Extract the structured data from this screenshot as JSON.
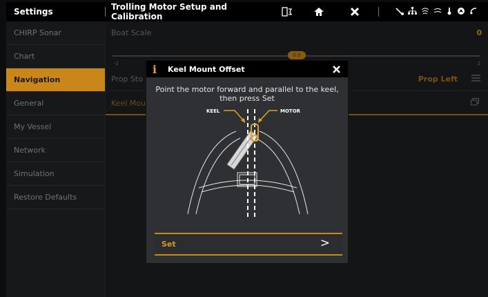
{
  "topbar": {
    "settings_title": "Settings",
    "page_title": "Trolling Motor Setup and Calibration"
  },
  "sidebar": {
    "items": [
      {
        "label": "CHIRP Sonar"
      },
      {
        "label": "Chart"
      },
      {
        "label": "Navigation",
        "active": true
      },
      {
        "label": "General"
      },
      {
        "label": "My Vessel"
      },
      {
        "label": "Network"
      },
      {
        "label": "Simulation"
      },
      {
        "label": "Restore Defaults"
      }
    ]
  },
  "main": {
    "boat_scale": {
      "label": "Boat Scale",
      "value": "0",
      "slider_value": "0.0",
      "min": "-2",
      "max": "2"
    },
    "prop_stow": {
      "label": "Prop Sto",
      "value": "Prop Left"
    },
    "keel_mount": {
      "label": "Keel Mou"
    }
  },
  "dialog": {
    "title": "Keel Mount Offset",
    "message_line1": "Point the motor forward and parallel to the keel,",
    "message_line2": "then press Set",
    "keel_label": "KEEL",
    "motor_label": "MOTOR",
    "set_label": "Set",
    "arrow": ">"
  },
  "colors": {
    "accent": "#c9871a",
    "background": "#1b1d1f"
  }
}
